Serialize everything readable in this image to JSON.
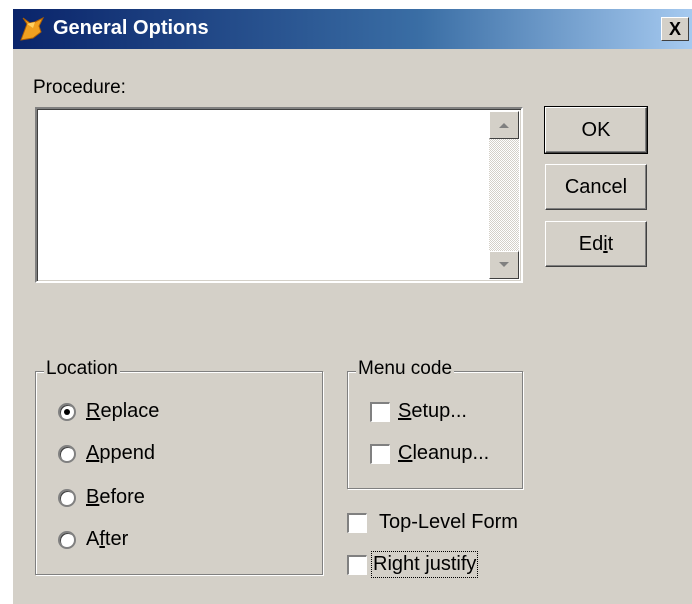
{
  "window": {
    "title": "General Options",
    "close_label": "X"
  },
  "procedure": {
    "label": "Procedure:",
    "value": ""
  },
  "buttons": {
    "ok": "OK",
    "cancel": "Cancel",
    "edit_pre": "Ed",
    "edit_u": "i",
    "edit_post": "t"
  },
  "location": {
    "legend": "Location",
    "selected": "Replace",
    "options": [
      {
        "u": "R",
        "rest": "eplace"
      },
      {
        "u": "A",
        "rest": "ppend"
      },
      {
        "u": "B",
        "rest": "efore"
      },
      {
        "pre": "A",
        "u": "f",
        "rest": "ter"
      }
    ]
  },
  "menu_code": {
    "legend": "Menu code",
    "setup": {
      "u": "S",
      "rest": "etup..."
    },
    "cleanup": {
      "u": "C",
      "rest": "leanup..."
    }
  },
  "top_level_form": {
    "label": "Top-Level Form",
    "checked": false
  },
  "right_justify": {
    "label": "Right justify",
    "checked": false
  }
}
